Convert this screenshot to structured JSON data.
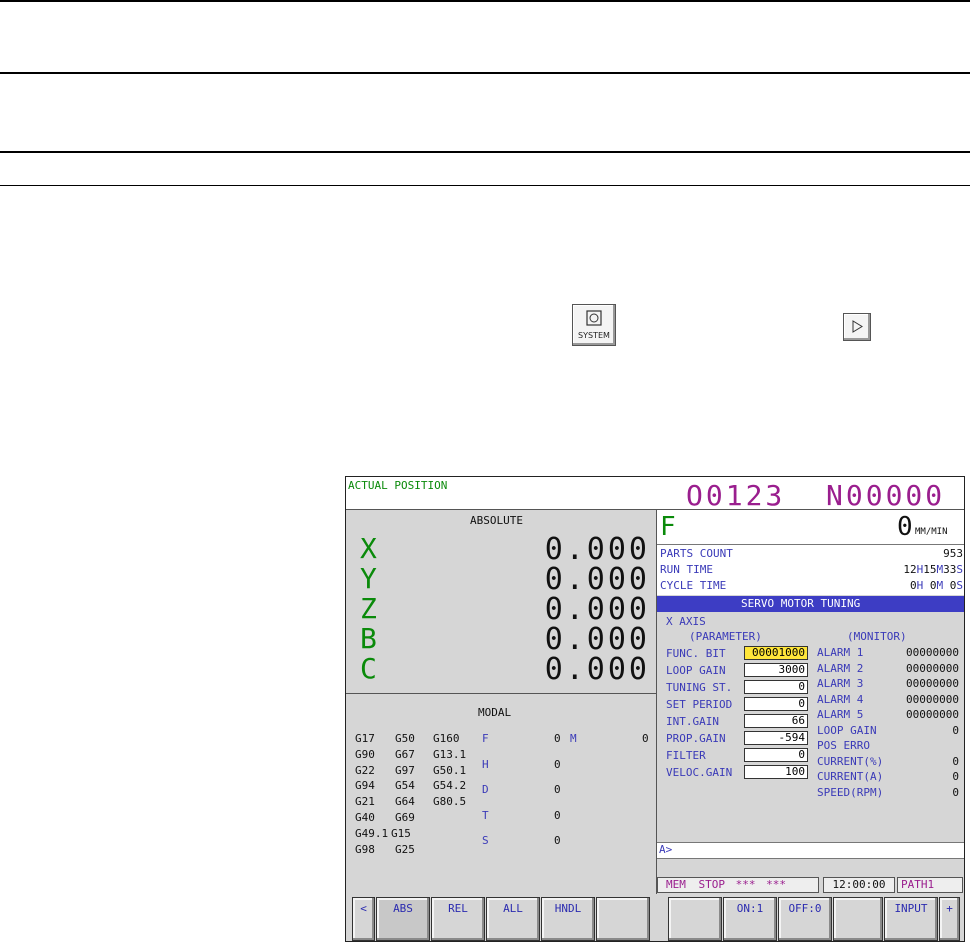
{
  "system_key_label": "SYSTEM",
  "screen": {
    "title": "ACTUAL POSITION",
    "program_no": "O0123",
    "sequence_no": "N00000",
    "absolute": {
      "header": "ABSOLUTE",
      "axes": [
        {
          "name": "X",
          "value": "0.000"
        },
        {
          "name": "Y",
          "value": "0.000"
        },
        {
          "name": "Z",
          "value": "0.000"
        },
        {
          "name": "B",
          "value": "0.000"
        },
        {
          "name": "C",
          "value": "0.000"
        }
      ]
    },
    "feed": {
      "label": "F",
      "value": "0",
      "unit": "MM/MIN"
    },
    "counters": {
      "parts_label": "PARTS COUNT",
      "parts_value": "953",
      "run_label": "RUN TIME",
      "run_h": "12",
      "run_m": "15",
      "run_s": "33",
      "cycle_label": "CYCLE TIME",
      "cycle_h": "0",
      "cycle_m": "0",
      "cycle_s": "0",
      "h": "H",
      "m": "M",
      "s": "S"
    },
    "tuning": {
      "title": "SERVO MOTOR TUNING",
      "axis": "X AXIS",
      "param_header": "(PARAMETER)",
      "monitor_header": "(MONITOR)",
      "params": [
        {
          "label": "FUNC. BIT",
          "value": "00001000"
        },
        {
          "label": "LOOP GAIN",
          "value": "3000"
        },
        {
          "label": "TUNING ST.",
          "value": "0"
        },
        {
          "label": "SET PERIOD",
          "value": "0"
        },
        {
          "label": "INT.GAIN",
          "value": "66"
        },
        {
          "label": "PROP.GAIN",
          "value": "-594"
        },
        {
          "label": "FILTER",
          "value": "0"
        },
        {
          "label": "VELOC.GAIN",
          "value": "100"
        }
      ],
      "monitor": [
        {
          "label": "ALARM 1",
          "value": "00000000"
        },
        {
          "label": "ALARM 2",
          "value": "00000000"
        },
        {
          "label": "ALARM 3",
          "value": "00000000"
        },
        {
          "label": "ALARM 4",
          "value": "00000000"
        },
        {
          "label": "ALARM 5",
          "value": "00000000"
        },
        {
          "label": "LOOP GAIN",
          "value": "0"
        },
        {
          "label": "POS ERRO",
          "value": ""
        },
        {
          "label": "CURRENT(%)",
          "value": "0"
        },
        {
          "label": "CURRENT(A)",
          "value": "0"
        },
        {
          "label": "SPEED(RPM)",
          "value": "0"
        }
      ]
    },
    "modal": {
      "header": "MODAL",
      "gcodes": [
        [
          "G17",
          "G50",
          "G160"
        ],
        [
          "G90",
          "G67",
          "G13.1"
        ],
        [
          "G22",
          "G97",
          "G50.1"
        ],
        [
          "G94",
          "G54",
          "G54.2"
        ],
        [
          "G21",
          "G64",
          "G80.5"
        ],
        [
          "G40",
          "G69",
          ""
        ],
        [
          "G49.1",
          "G15",
          ""
        ],
        [
          "G98",
          "G25",
          ""
        ]
      ],
      "codes": [
        {
          "label": "F",
          "value": "0"
        },
        {
          "label": "H",
          "value": "0"
        },
        {
          "label": "D",
          "value": "0"
        },
        {
          "label": "T",
          "value": "0"
        },
        {
          "label": "S",
          "value": "0"
        }
      ],
      "m_label": "M",
      "m_value": "0"
    },
    "input_prompt": "A>",
    "status": {
      "mode": "MEM",
      "state": "STOP",
      "stars1": "***",
      "stars2": "***",
      "time": "12:00:00",
      "path": "PATH1"
    },
    "softkeys": {
      "left": "<",
      "abs": "ABS",
      "rel": "REL",
      "all": "ALL",
      "hndl": "HNDL",
      "on": "ON:1",
      "off": "OFF:0",
      "input": "INPUT",
      "right": "+"
    }
  }
}
